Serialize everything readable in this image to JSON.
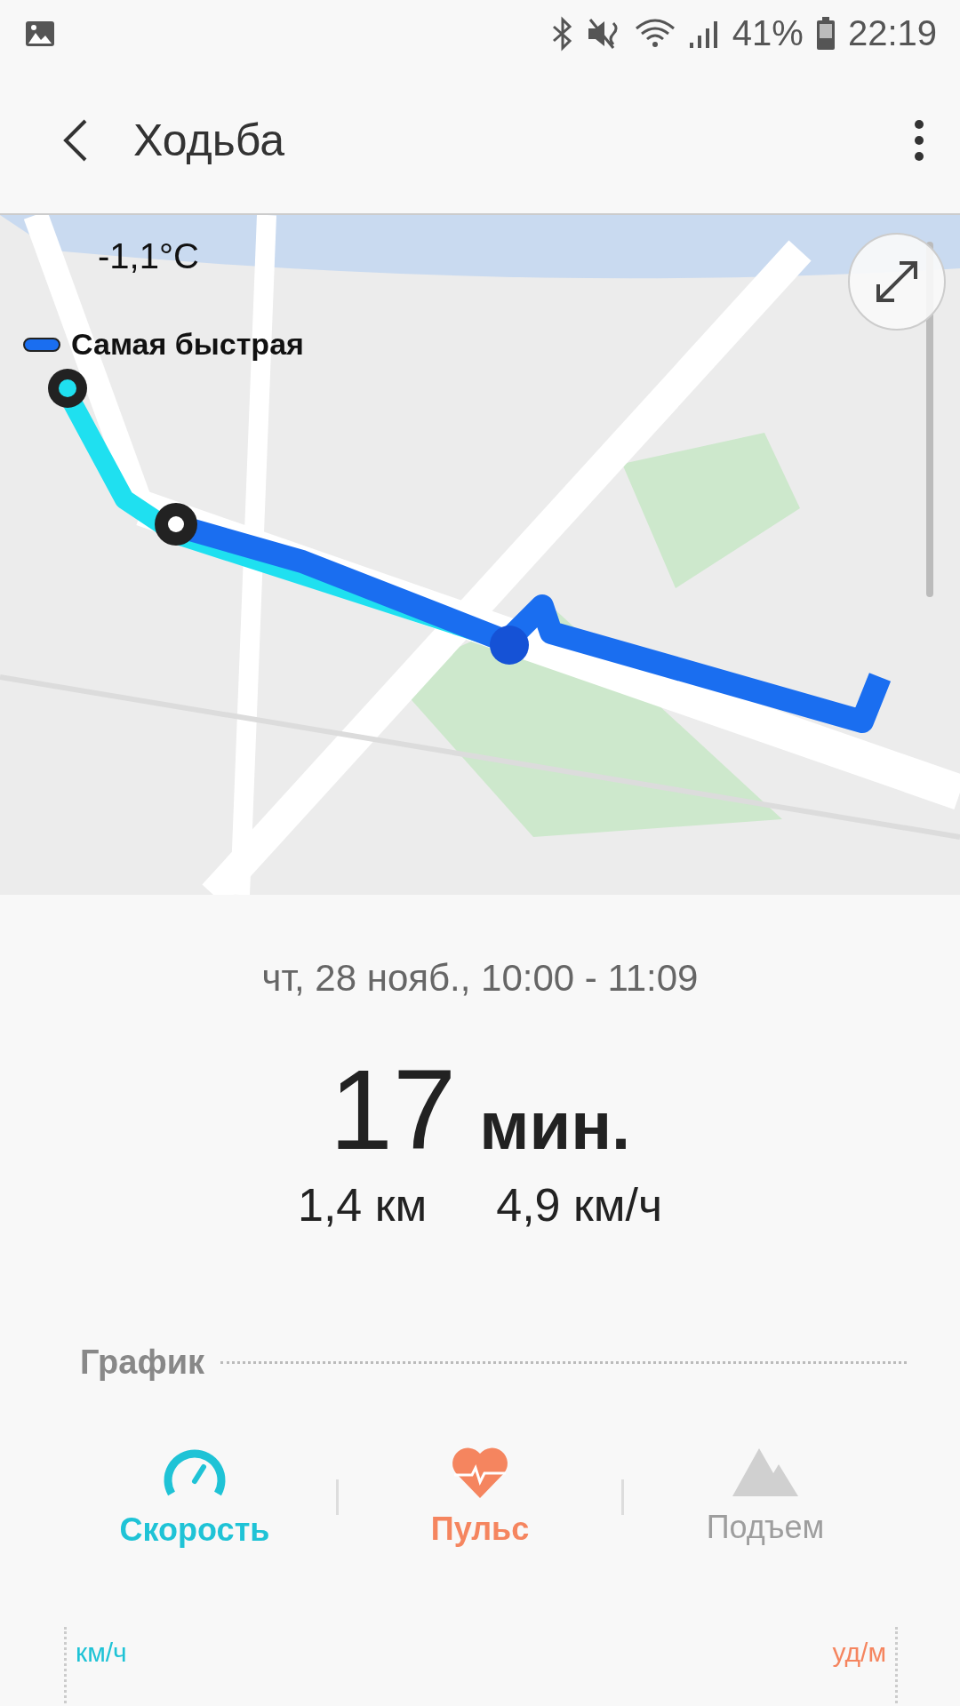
{
  "status_bar": {
    "battery": "41%",
    "time": "22:19"
  },
  "app_bar": {
    "title": "Ходьба"
  },
  "map": {
    "kind": "picture",
    "temperature": "-1,1°C",
    "legend": "Самая быстрая"
  },
  "summary": {
    "date": "чт, 28 нояб., 10:00 - 11:09",
    "duration_value": "17",
    "duration_unit": "мин.",
    "distance": "1,4 км",
    "speed": "4,9 км/ч"
  },
  "graph": {
    "title": "График",
    "metrics": [
      {
        "kind": "speed",
        "label": "Скорость",
        "selected": true,
        "color": "#1fc3d6"
      },
      {
        "kind": "pulse",
        "label": "Пульс",
        "selected": true,
        "color": "#f5855f"
      },
      {
        "kind": "elevation",
        "label": "Подъем",
        "selected": false,
        "color": "#9e9e9e"
      }
    ],
    "left_unit": "км/ч",
    "right_unit": "уд/м"
  }
}
